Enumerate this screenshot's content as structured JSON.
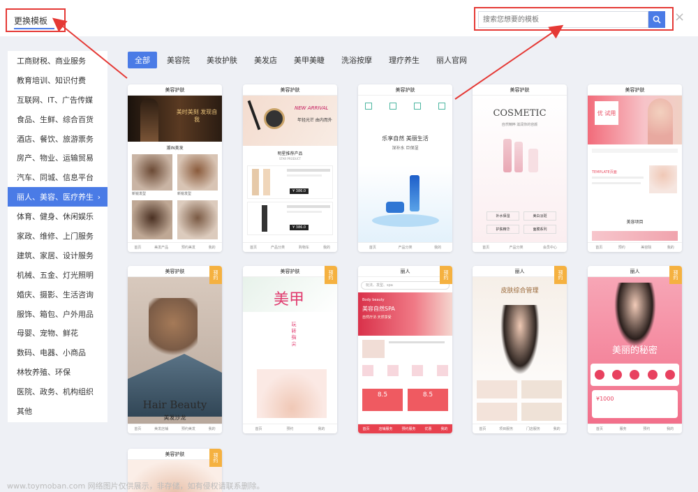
{
  "header": {
    "change_template": "更换模板",
    "search_placeholder": "搜索您想要的模板",
    "close": "×"
  },
  "sidebar": {
    "items": [
      "工商财税、商业服务",
      "教育培训、知识付费",
      "互联网、IT、广告传媒",
      "食品、生鲜、综合百货",
      "酒店、餐饮、旅游票务",
      "房产、物业、运输贸易",
      "汽车、同城、信息平台",
      "丽人、美容、医疗养生",
      "体育、健身、休闲娱乐",
      "家政、维修、上门服务",
      "建筑、家居、设计服务",
      "机械、五金、灯光照明",
      "婚庆、摄影、生活咨询",
      "服饰、箱包、户外用品",
      "母婴、宠物、鲜花",
      "数码、电器、小商品",
      "林牧养殖、环保",
      "医院、政务、机构组织",
      "其他"
    ],
    "active_index": 7
  },
  "tabs": [
    "全部",
    "美容院",
    "美妆护肤",
    "美发店",
    "美甲美睫",
    "洗浴按摩",
    "理疗养生",
    "丽人官网"
  ],
  "cards": {
    "c1": {
      "title": "美容护肤",
      "banner": "美时美刻 发现自我",
      "sub": "潮IN美发",
      "cap": "新锐发型",
      "foot": [
        "首页",
        "美发产品",
        "预约美发",
        "我的"
      ]
    },
    "c2": {
      "title": "美容护肤",
      "new": "NEW ARRIVAL",
      "slogan": "年轻光芒 由内而外",
      "section": "明星推荐产品",
      "section_en": "STAR PRODUCT",
      "price": "¥ 386.0",
      "foot": [
        "首页",
        "产品分类",
        "购物车",
        "我的"
      ]
    },
    "c3": {
      "title": "美容护肤",
      "slogan": "乐享自然 美丽生活",
      "sub": "深补水 巨保湿",
      "foot": [
        "首页",
        "产品分类",
        "我的"
      ]
    },
    "c4": {
      "title": "美容护肤",
      "brand": "COSMETIC",
      "brand_sub": "自然精粹 滋润你的容颜",
      "btns": [
        "补水保湿",
        "美白淡斑",
        "护肤精华",
        "面膜系列"
      ],
      "foot": [
        "首页",
        "产品分类",
        "会员中心"
      ]
    },
    "c5": {
      "title": "美容护肤",
      "badge": "优 试用",
      "section": "TEMPLATE页面",
      "foot": [
        "首页",
        "预约",
        "美容院",
        "我的"
      ],
      "label": "美容项目"
    },
    "c6": {
      "title": "美容护肤",
      "corner": "预约",
      "headline": "Hair Beauty",
      "sub": "美发沙龙",
      "foot": [
        "首页",
        "美发店铺",
        "预约美发",
        "我的"
      ]
    },
    "c7": {
      "title": "美容护肤",
      "corner": "预约",
      "big": "美甲",
      "sub": "玩 转 指 尖",
      "foot": [
        "首页",
        "预约",
        "我的"
      ]
    },
    "c8": {
      "title": "丽人",
      "corner": "预约",
      "search": "玩法、发型、spa",
      "headline": "美容自然SPA",
      "en": "Body beauty",
      "sub": "自然疗法·天然享受",
      "price1": "8.5",
      "price2": "8.5",
      "foot": [
        "首页",
        "店铺服务",
        "预约服务",
        "优惠",
        "我的"
      ]
    },
    "c9": {
      "title": "丽人",
      "corner": "预约",
      "headline": "皮肤综合管理",
      "foot": [
        "首页",
        "项目服务",
        "门店服务",
        "我的"
      ]
    },
    "c10": {
      "title": "丽人",
      "corner": "预约",
      "headline": "美丽的秘密",
      "price": "¥1000",
      "foot": [
        "首页",
        "服务",
        "预约",
        "我的"
      ]
    },
    "c11": {
      "title": "美容护肤",
      "corner": "预约"
    }
  },
  "watermark": "www.toymoban.com 网络图片仅供展示，非存储，如有侵权请联系删除。",
  "colors": {
    "accent": "#4a7be6",
    "highlight": "#e53935",
    "corner": "#f5b140"
  }
}
